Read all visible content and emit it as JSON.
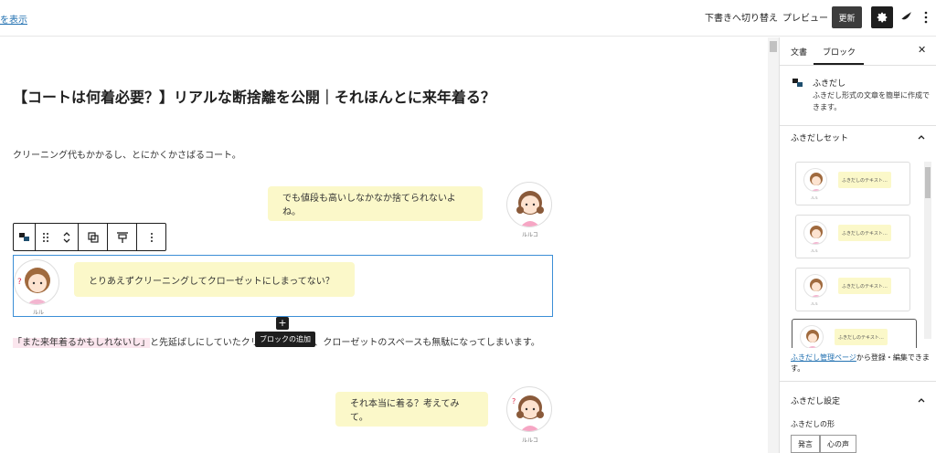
{
  "topbar": {
    "show_link": "を表示",
    "switch_draft": "下書きへ切り替え",
    "preview": "プレビュー",
    "update": "更新"
  },
  "post": {
    "title": "【コートは何着必要？】リアルな断捨離を公開｜それほんとに来年着る？",
    "para1": "クリーニング代もかかるし、とにかくかさばるコート。",
    "bubble1": "でも値段も高いしなかなか捨てられないよね。",
    "bubble1_name": "ルルコ",
    "bubble2": "とりあえずクリーニングしてクローゼットにしまってない？",
    "bubble2_name": "ルル",
    "para2_marker": "「また来年着るかもしれないし」",
    "para2_rest": "と先延ばしにしていたクリーニング代も、クローゼットのスペースも無駄になってしまいます。",
    "bubble3": "それ本当に着る？考えてみて。",
    "bubble3_name": "ルルコ",
    "add_block_tooltip": "ブロックの追加"
  },
  "sidebar": {
    "tab_document": "文書",
    "tab_block": "ブロック",
    "block_title": "ふきだし",
    "block_desc": "ふきだし形式の文章を簡単に作成できます。",
    "preset_head": "ふきだしセット",
    "presets": [
      {
        "text": "ふきだしのテキスト…",
        "name": "ルル"
      },
      {
        "text": "ふきだしのテキスト…",
        "name": "ルル"
      },
      {
        "text": "ふきだしのテキスト…",
        "name": "ルル"
      },
      {
        "text": "ふきだしのテキスト…",
        "name": "ルル"
      }
    ],
    "manage_link": "ふきだし管理ページ",
    "manage_rest": "から登録・編集できます。",
    "settings_head": "ふきだし設定",
    "shape_label": "ふきだしの形",
    "shape_options": [
      "発言",
      "心の声"
    ]
  },
  "colors": {
    "bubble": "#fbf8c9",
    "accent": "#2271b1",
    "selection": "#3b8ed6",
    "dark": "#1e1e1e"
  }
}
